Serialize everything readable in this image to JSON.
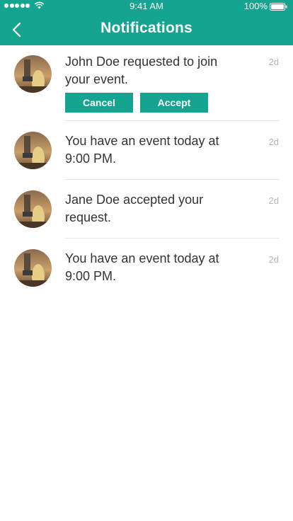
{
  "status_bar": {
    "time": "9:41 AM",
    "battery": "100%"
  },
  "header": {
    "title": "Notifications",
    "back_icon": "chevron-left-icon"
  },
  "notifications": [
    {
      "message": "John Doe requested to join your event.",
      "time": "2d",
      "actions": {
        "cancel": "Cancel",
        "accept": "Accept"
      }
    },
    {
      "message": "You have an event today at 9:00 PM.",
      "time": "2d"
    },
    {
      "message": "Jane Doe accepted your request.",
      "time": "2d"
    },
    {
      "message": "You have an event today at 9:00 PM.",
      "time": "2d"
    }
  ],
  "colors": {
    "accent": "#14a48f",
    "text": "#333333",
    "muted": "#b5b5b5",
    "divider": "#e6e6e6"
  }
}
